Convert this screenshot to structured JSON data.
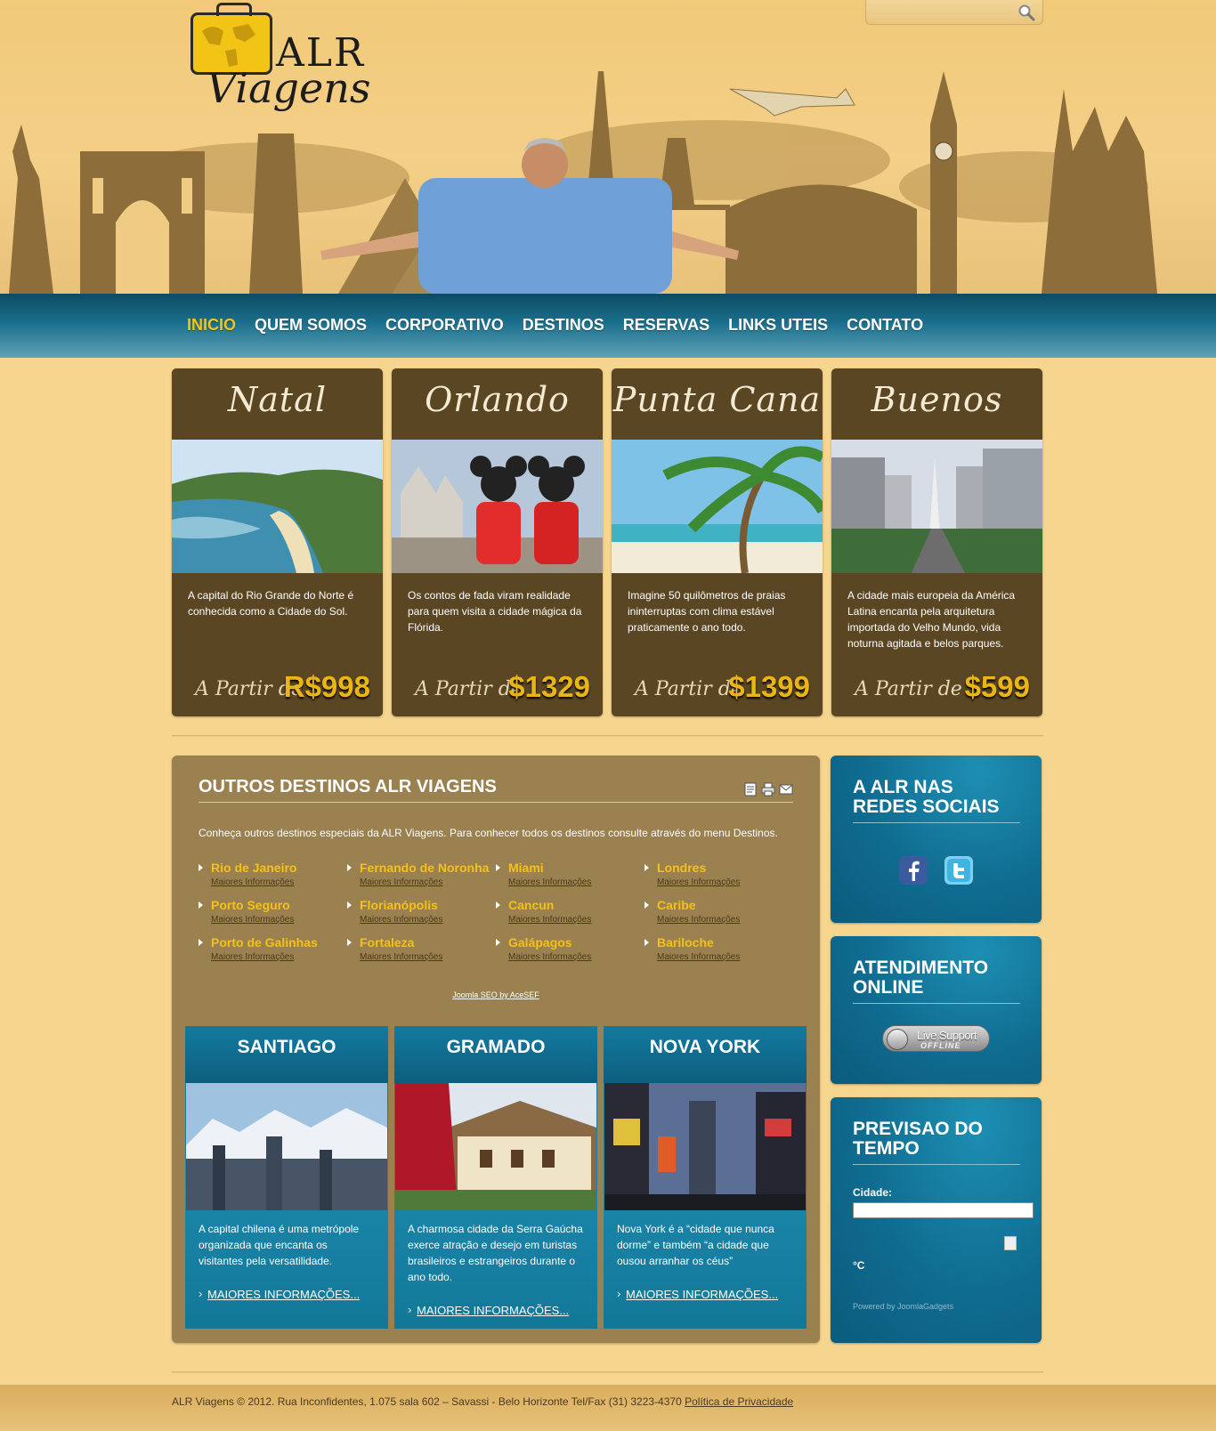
{
  "search": {
    "placeholder": ""
  },
  "logo": {
    "line1": "ALR",
    "line2": "Viagens"
  },
  "nav": {
    "items": [
      "INICIO",
      "QUEM SOMOS",
      "CORPORATIVO",
      "DESTINOS",
      "RESERVAS",
      "LINKS UTEIS",
      "CONTATO"
    ],
    "active": "INICIO"
  },
  "featured": [
    {
      "title": "Natal",
      "desc": "A capital do Rio Grande do Norte é conhecida como a Cidade do Sol.",
      "from": "A Partir de",
      "price": "R$998"
    },
    {
      "title": "Orlando",
      "desc": "Os contos de fada viram realidade para quem visita a cidade mágica da Flórida.",
      "from": "A Partir de",
      "price": "$1329"
    },
    {
      "title": "Punta Cana",
      "desc": "Imagine 50 quilômetros de praias ininterruptas com clima estável praticamente o ano todo.",
      "from": "A Partir de",
      "price": "$1399"
    },
    {
      "title": "Buenos Aires",
      "desc": "A cidade mais europeia da América Latina encanta pela arquitetura importada do Velho Mundo, vida noturna agitada e belos parques.",
      "from": "A Partir de",
      "price": "$599"
    }
  ],
  "outros": {
    "title": "OUTROS DESTINOS ALR VIAGENS",
    "intro": "Conheça outros destinos especiais da ALR Viagens. Para conhecer todos os destinos consulte através do menu Destinos.",
    "more_label": "Maiores Informações",
    "destinations": [
      "Rio de Janeiro",
      "Fernando de Noronha",
      "Miami",
      "Londres",
      "Porto Seguro",
      "Florianópolis",
      "Cancun",
      "Caribe",
      "Porto de Galinhas",
      "Fortaleza",
      "Galápagos",
      "Bariloche"
    ],
    "seo": "Joomla SEO by AceSEF"
  },
  "cities": [
    {
      "title": "SANTIAGO",
      "desc": "A capital chilena é uma metrópole organizada que encanta os visitantes pela versatilidade.",
      "more": "MAIORES INFORMAÇÕES..."
    },
    {
      "title": "GRAMADO",
      "desc": "A charmosa cidade da Serra Gaúcha exerce atração e desejo em turistas brasileiros e estrangeiros durante o ano todo.",
      "more": "MAIORES INFORMAÇÕES..."
    },
    {
      "title": "NOVA YORK",
      "desc": "Nova York é a “cidade que nunca dorme” e também “a cidade que ousou arranhar os céus”",
      "more": "MAIORES INFORMAÇÕES..."
    }
  ],
  "sidebar": {
    "social_title": "A ALR NAS REDES SOCIAIS",
    "support_title": "ATENDIMENTO ONLINE",
    "support_label": "Live Support",
    "support_status": "OFFLINE",
    "weather_title": "PREVISAO DO TEMPO",
    "weather_city_label": "Cidade:",
    "weather_unit": "°C",
    "weather_powered": "Powered by JoomlaGadgets"
  },
  "footer": {
    "text": "ALR Viagens © 2012. Rua Inconfidentes, 1.075 sala 602 – Savassi - Belo Horizonte Tel/Fax (31) 3223-4370 ",
    "privacy": "Política de Privacidade"
  },
  "colors": {
    "accent": "#f6c515",
    "nav": "#1a6f8c",
    "card": "#5a4623",
    "panel": "#9b8050",
    "blue": "#0f6c90"
  }
}
